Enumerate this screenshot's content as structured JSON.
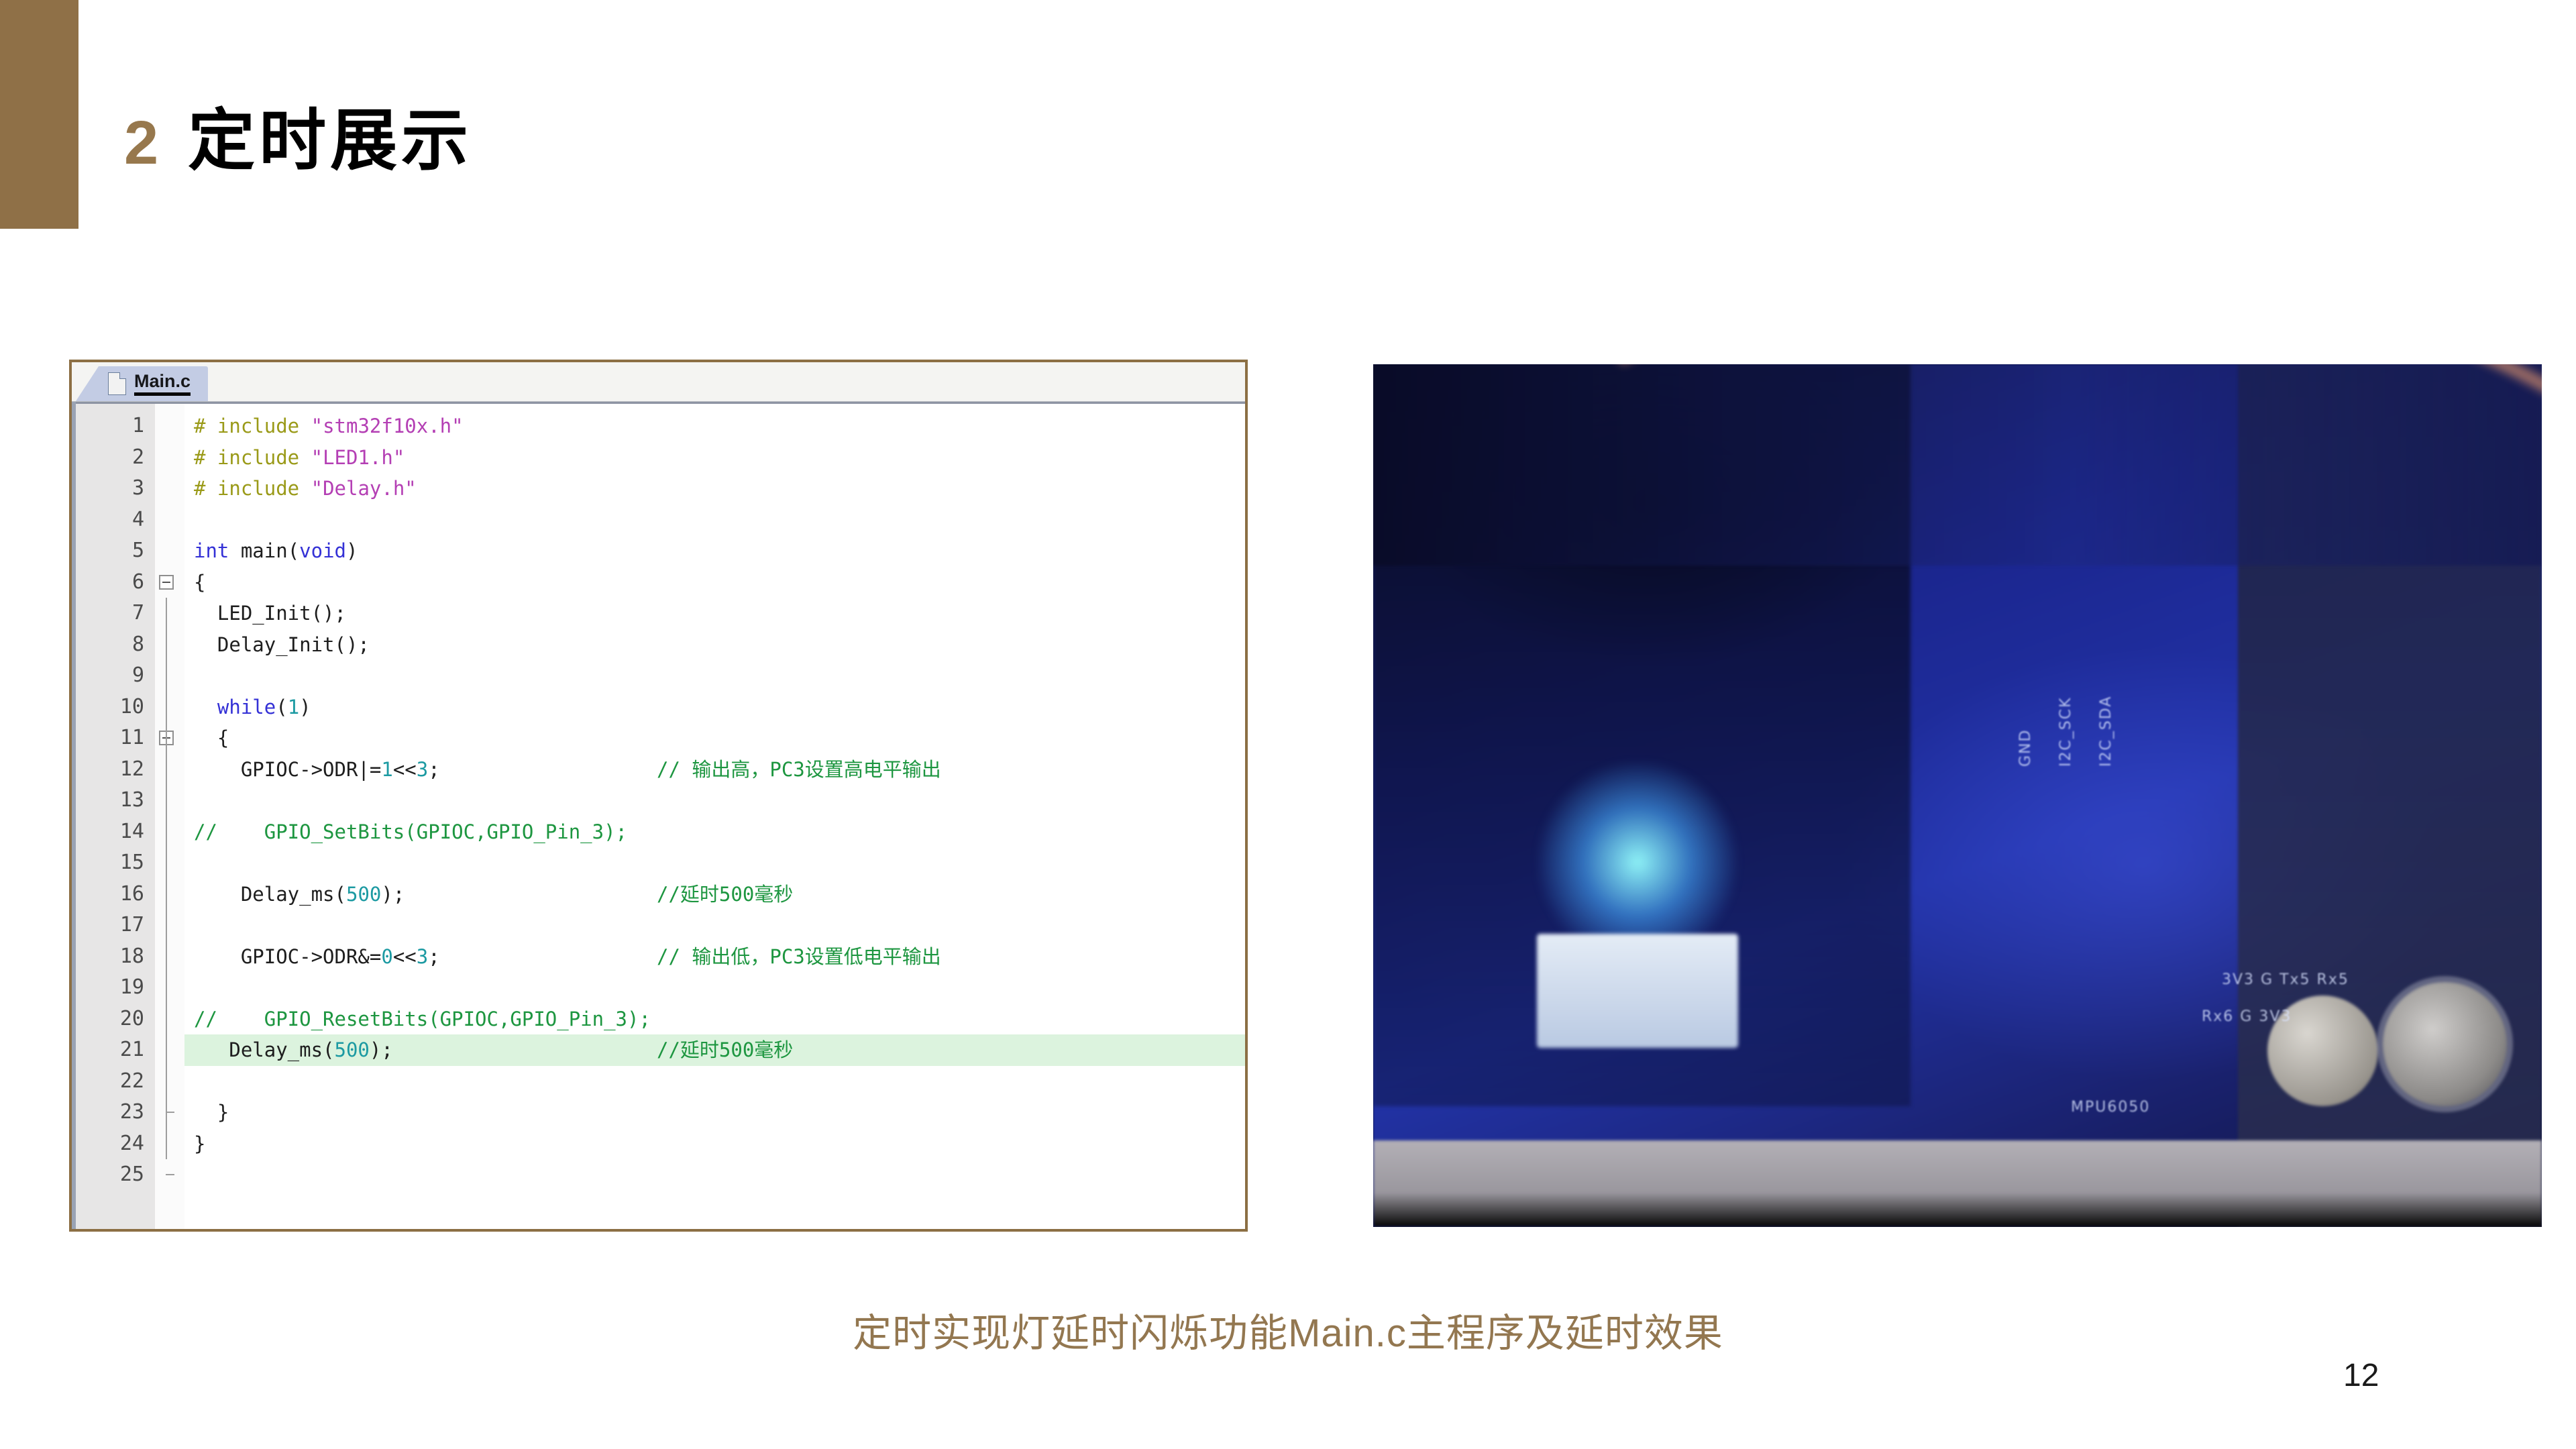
{
  "slide": {
    "title_number": "2",
    "title_text": "定时展示",
    "caption": "定时实现灯延时闪烁功能Main.c主程序及延时效果",
    "page_number": "12",
    "accent_color": "#8F7047",
    "title_number_color": "#97784D",
    "caption_color": "#937750"
  },
  "editor": {
    "tab_label": "Main.c",
    "tab_icon": "document-icon",
    "highlight_line": 21,
    "total_lines": 25,
    "colors": {
      "preprocessor": "#9A9A18",
      "string": "#B43FB4",
      "keyword": "#3431D6",
      "number": "#1C9AA2",
      "comment": "#1D9640",
      "plain": "#1E1E1E",
      "current_line_bg": "#DCF3DE",
      "gutter_bg": "#E7E6E6",
      "border": "#8C6F44"
    },
    "lines": [
      {
        "n": "1",
        "tokens": [
          {
            "t": "# include ",
            "c": "pre"
          },
          {
            "t": "\"stm32f10x.h\"",
            "c": "str"
          }
        ]
      },
      {
        "n": "2",
        "tokens": [
          {
            "t": "# include ",
            "c": "pre"
          },
          {
            "t": "\"LED1.h\"",
            "c": "str"
          }
        ]
      },
      {
        "n": "3",
        "tokens": [
          {
            "t": "# include ",
            "c": "pre"
          },
          {
            "t": "\"Delay.h\"",
            "c": "str"
          }
        ]
      },
      {
        "n": "4",
        "tokens": []
      },
      {
        "n": "5",
        "tokens": [
          {
            "t": "int",
            "c": "kw"
          },
          {
            "t": " main(",
            "c": "plain"
          },
          {
            "t": "void",
            "c": "kw"
          },
          {
            "t": ")",
            "c": "plain"
          }
        ]
      },
      {
        "n": "6",
        "tokens": [
          {
            "t": "{",
            "c": "plain"
          }
        ]
      },
      {
        "n": "7",
        "tokens": [
          {
            "t": "  LED_Init();",
            "c": "plain"
          }
        ]
      },
      {
        "n": "8",
        "tokens": [
          {
            "t": "  Delay_Init();",
            "c": "plain"
          }
        ]
      },
      {
        "n": "9",
        "tokens": []
      },
      {
        "n": "10",
        "tokens": [
          {
            "t": "  ",
            "c": "plain"
          },
          {
            "t": "while",
            "c": "kw"
          },
          {
            "t": "(",
            "c": "plain"
          },
          {
            "t": "1",
            "c": "num"
          },
          {
            "t": ")",
            "c": "plain"
          }
        ]
      },
      {
        "n": "11",
        "tokens": [
          {
            "t": "  {",
            "c": "plain"
          }
        ]
      },
      {
        "n": "12",
        "tokens": [
          {
            "t": "    GPIOC->ODR|=",
            "c": "plain"
          },
          {
            "t": "1",
            "c": "num"
          },
          {
            "t": "<<",
            "c": "plain"
          },
          {
            "t": "3",
            "c": "num"
          },
          {
            "t": ";",
            "c": "plain"
          }
        ],
        "comment": "// 输出高，PC3设置高电平输出"
      },
      {
        "n": "13",
        "tokens": []
      },
      {
        "n": "14",
        "tokens": [
          {
            "t": "//    GPIO_SetBits(GPIOC,GPIO_Pin_3);",
            "c": "cmt"
          }
        ]
      },
      {
        "n": "15",
        "tokens": []
      },
      {
        "n": "16",
        "tokens": [
          {
            "t": "    Delay_ms(",
            "c": "plain"
          },
          {
            "t": "500",
            "c": "num"
          },
          {
            "t": ");",
            "c": "plain"
          }
        ],
        "comment": "//延时500毫秒"
      },
      {
        "n": "17",
        "tokens": []
      },
      {
        "n": "18",
        "tokens": [
          {
            "t": "    GPIOC->ODR&=",
            "c": "plain"
          },
          {
            "t": "0",
            "c": "num"
          },
          {
            "t": "<<",
            "c": "plain"
          },
          {
            "t": "3",
            "c": "num"
          },
          {
            "t": ";",
            "c": "plain"
          }
        ],
        "comment": "// 输出低，PC3设置低电平输出"
      },
      {
        "n": "19",
        "tokens": []
      },
      {
        "n": "20",
        "tokens": [
          {
            "t": "//    GPIO_ResetBits(GPIOC,GPIO_Pin_3);",
            "c": "cmt"
          }
        ]
      },
      {
        "n": "21",
        "tokens": [
          {
            "t": "   Delay_ms(",
            "c": "plain"
          },
          {
            "t": "500",
            "c": "num"
          },
          {
            "t": ");",
            "c": "plain"
          }
        ],
        "comment": "//延时500毫秒",
        "highlighted": true
      },
      {
        "n": "22",
        "tokens": []
      },
      {
        "n": "23",
        "tokens": [
          {
            "t": "  }",
            "c": "plain"
          }
        ]
      },
      {
        "n": "24",
        "tokens": [
          {
            "t": "}",
            "c": "plain"
          }
        ]
      },
      {
        "n": "25",
        "tokens": []
      }
    ]
  },
  "photo": {
    "description": "blurred photo of an STM32 development board lit by blue LEDs with ribbon cables",
    "silkscreen_labels": [
      "I2C_SDA",
      "I2C_SCK",
      "GND",
      "MPU6050",
      "3V3  G  Tx5  Rx5",
      "Rx6  G  3V3"
    ]
  }
}
